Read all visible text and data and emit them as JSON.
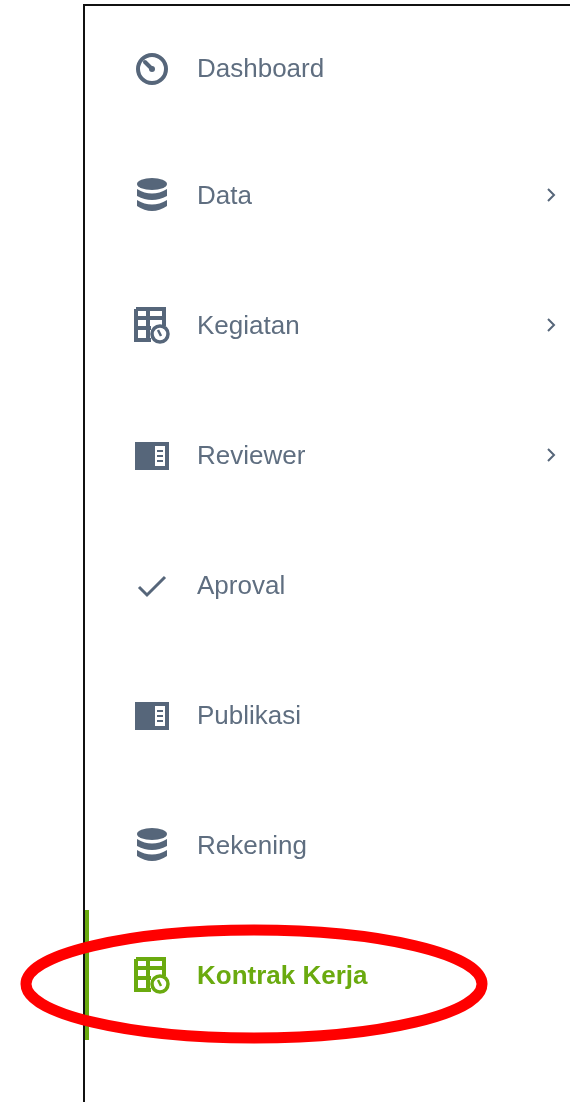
{
  "sidebar": {
    "items": [
      {
        "kind": "gauge",
        "label": "Dashboard",
        "has_submenu": false,
        "selected": false
      },
      {
        "kind": "database",
        "label": "Data",
        "has_submenu": true,
        "selected": false
      },
      {
        "kind": "table-clock",
        "label": "Kegiatan",
        "has_submenu": true,
        "selected": false
      },
      {
        "kind": "panel",
        "label": "Reviewer",
        "has_submenu": true,
        "selected": false
      },
      {
        "kind": "check",
        "label": "Aproval",
        "has_submenu": false,
        "selected": false
      },
      {
        "kind": "panel",
        "label": "Publikasi",
        "has_submenu": false,
        "selected": false
      },
      {
        "kind": "database",
        "label": "Rekening",
        "has_submenu": false,
        "selected": false
      },
      {
        "kind": "table-clock",
        "label": "Kontrak Kerja",
        "has_submenu": false,
        "selected": true
      }
    ]
  }
}
